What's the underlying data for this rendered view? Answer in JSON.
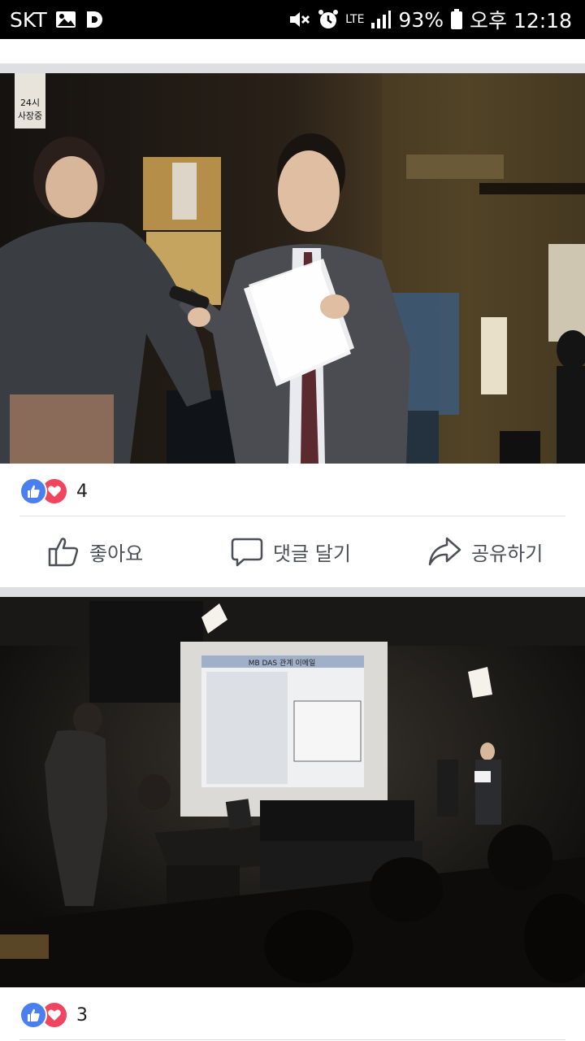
{
  "status_bar": {
    "carrier": "SKT",
    "network": "LTE",
    "battery": "93%",
    "time": "오후 12:18",
    "icons": [
      "image-icon",
      "d-app-icon",
      "mute-icon",
      "alarm-icon",
      "signal-icon",
      "battery-icon"
    ]
  },
  "post1": {
    "poster_text": "24시\n사장중",
    "reaction_count": "4",
    "actions": {
      "like": "좋아요",
      "comment": "댓글 달기",
      "share": "공유하기"
    }
  },
  "post2": {
    "screen_title": "MB  DAS 관계 이메일",
    "reaction_count": "3"
  },
  "colors": {
    "like_blue": "#4a7ff0",
    "love_red": "#f0455e",
    "action_gray": "#4b4f56",
    "feed_bg": "#dddfe2"
  }
}
